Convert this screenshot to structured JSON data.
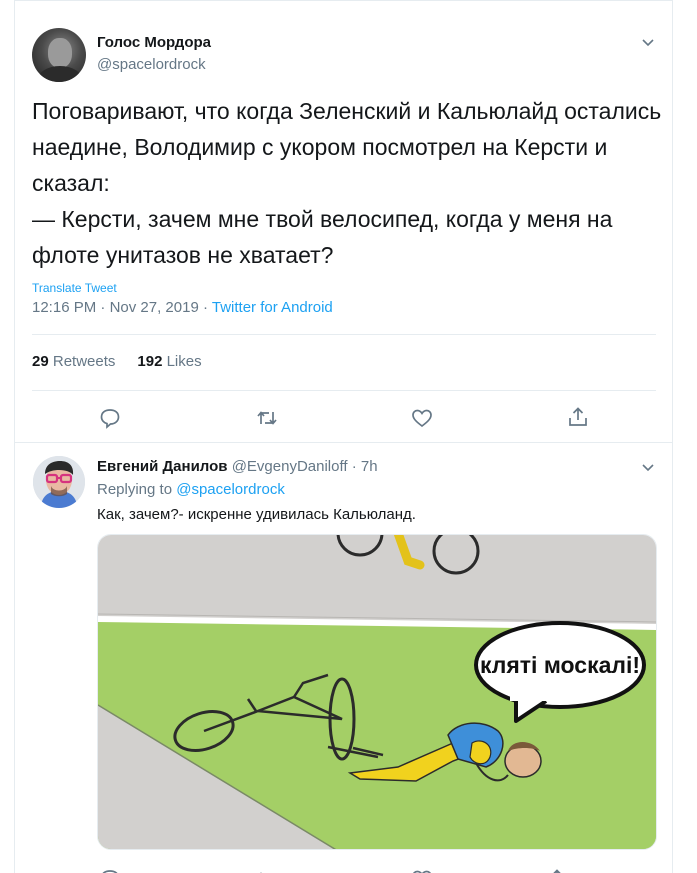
{
  "main_tweet": {
    "author_name": "Голос Мордора",
    "author_handle": "@spacelordrock",
    "text": "Поговаривают, что когда Зеленский и Кальюлайд остались наедине, Володимир с укором посмотрел на Керсти и сказал:\n— Керсти, зачем мне твой велосипед, когда у меня на флоте унитазов не хватает?",
    "translate_label": "Translate Tweet",
    "time": "12:16 PM",
    "date": "Nov 27, 2019",
    "source": "Twitter for Android",
    "retweets_count": "29",
    "retweets_label": "Retweets",
    "likes_count": "192",
    "likes_label": "Likes",
    "actions": [
      "reply-icon",
      "retweet-icon",
      "like-icon",
      "share-icon"
    ]
  },
  "reply_tweet": {
    "author_name": "Евгений Данилов",
    "author_handle": "@EvgenyDaniloff",
    "age": "7h",
    "replying_prefix": "Replying to",
    "replying_to": "@spacelordrock",
    "text": "Как, зачем?- искренне удивилась Кальюланд.",
    "image_speech_text": "кляті москалі!"
  },
  "colors": {
    "accent": "#1da1f2",
    "secondary_text": "#657786",
    "border": "#e6ecf0"
  }
}
